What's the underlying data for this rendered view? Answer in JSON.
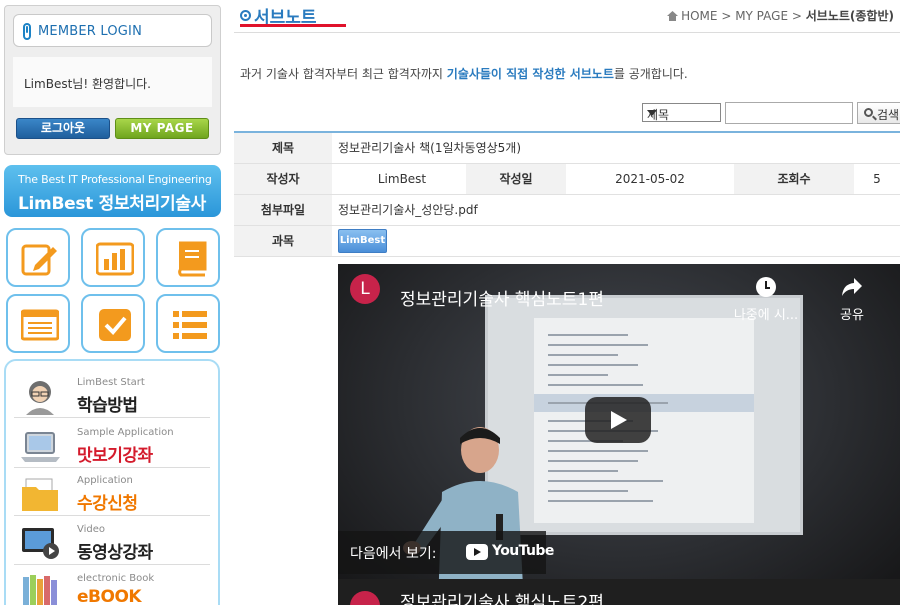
{
  "login": {
    "title": "MEMBER LOGIN",
    "welcome": "LimBest님! 환영합니다.",
    "logout_label": "로그아웃",
    "mypage_label": "MY PAGE"
  },
  "banner": {
    "line1": "The Best IT Professional Engineering",
    "line2": "LimBest 정보처리기술사"
  },
  "quick_icons": [
    "pencil-icon",
    "bar-chart-icon",
    "book-icon",
    "list-card-icon",
    "checkbox-icon",
    "list-icon"
  ],
  "side_menu": [
    {
      "sub": "LimBest Start",
      "main": "학습방법",
      "icon": "student-icon"
    },
    {
      "sub": "Sample Application",
      "main": "맛보기강좌",
      "icon": "laptop-icon"
    },
    {
      "sub": "Application",
      "main": "수강신청",
      "icon": "folder-icon"
    },
    {
      "sub": "Video",
      "main": "동영상강좌",
      "icon": "monitor-icon"
    },
    {
      "sub": "electronic Book",
      "main": "eBOOK",
      "icon": "books-icon"
    }
  ],
  "page": {
    "title": "서브노트",
    "breadcrumb": [
      "HOME",
      "MY PAGE",
      "서브노트(종합반)"
    ],
    "intro_before": "과거 기술사 합격자부터 최근 합격자까지 ",
    "intro_highlight": "기술사들이 직접 작성한 서브노트",
    "intro_after": "를 공개합니다."
  },
  "search": {
    "select_value": "제목",
    "input_value": "",
    "button_label": "검색"
  },
  "post": {
    "title_label": "제목",
    "title_value": "정보관리기술사 책(1일차동영상5개)",
    "author_label": "작성자",
    "author_value": "LimBest",
    "date_label": "작성일",
    "date_value": "2021-05-02",
    "views_label": "조회수",
    "views_value": "5",
    "file_label": "첨부파일",
    "file_value": "정보관리기술사_성안당.pdf",
    "subject_label": "과목",
    "subject_badge": "LimBest"
  },
  "video": {
    "channel_initial": "L",
    "title": "정보관리기술사 핵심노트1편",
    "watch_later": "나중에 시...",
    "share": "공유",
    "watch_on": "다음에서 보기:",
    "youtube": "YouTube",
    "next_title": "정보관리기술사 핵심노트2편"
  },
  "colors": {
    "accent_blue": "#2a7bbf",
    "title_underline": "#e0122b",
    "logout_button": "#2a73b5",
    "mypage_button": "#8cc133",
    "tile_border": "#6fc0ec",
    "icon_orange": "#f39a1e"
  }
}
